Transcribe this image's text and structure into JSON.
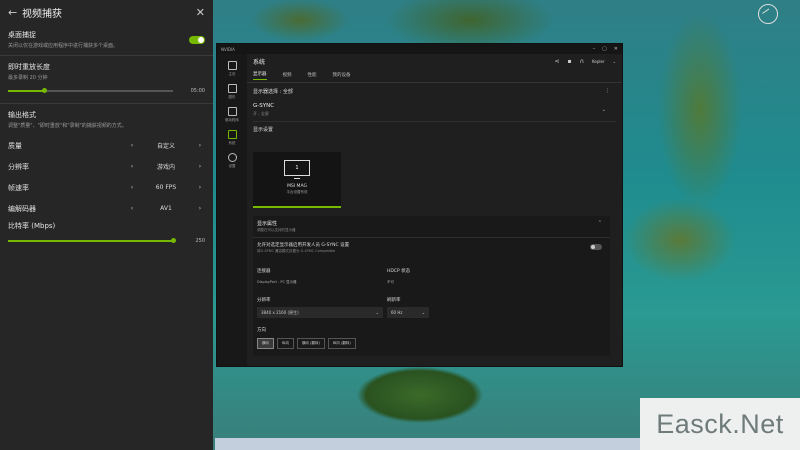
{
  "panel": {
    "title": "视频捕获",
    "desktop_capture": {
      "label": "桌面捕捉",
      "desc": "关闭以仅在游戏或应用程序中进行捕获多个桌面。",
      "enabled": true
    },
    "instant_replay": {
      "label": "即时重放长度",
      "desc": "最多录制 20 分钟",
      "value": "05:00",
      "fraction": 0.22
    },
    "output_format": {
      "label": "输出格式",
      "desc": "调整\"质量\"、\"即时重放\"和\"录制\"的捕获视频的方式。"
    },
    "options": [
      {
        "name": "质量",
        "value": "自定义"
      },
      {
        "name": "分辨率",
        "value": "游戏内"
      },
      {
        "name": "帧速率",
        "value": "60 FPS"
      },
      {
        "name": "编解码器",
        "value": "AV1"
      }
    ],
    "bitrate": {
      "label": "比特率 (Mbps)",
      "value": "250",
      "fraction": 1.0
    }
  },
  "window": {
    "app_name": "NVIDIA",
    "page_title": "系统",
    "account": "Kepler",
    "nav": [
      {
        "label": "主页"
      },
      {
        "label": "图形"
      },
      {
        "label": "驱动程序"
      },
      {
        "label": "系统"
      },
      {
        "label": "设置"
      }
    ],
    "tabs": [
      "显示器",
      "视频",
      "性能",
      "我的设备"
    ],
    "active_tab": 0,
    "select_display": "显示器选择 : 全部",
    "gsync": {
      "title": "G-SYNC",
      "sub": "开 , 全屏"
    },
    "display_settings": "显示设置",
    "monitor": {
      "number": "1",
      "name": "MSI MAG",
      "sub": "平台设置有效"
    },
    "props": {
      "title": "显示属性",
      "sub": "调整在可以支持的显示器",
      "gsync_toggle_label": "允许对选定显示器启用开发人员 G-SYNC 设置",
      "gsync_toggle_sub": "将G-SYNC 兼容模式设置为 G-SYNC Compatible",
      "connection_label": "连接器",
      "connection_value": "DisplayPort - PC 显示器",
      "hdcp_label": "HDCP 状态",
      "hdcp_value": "不可",
      "resolution_label": "分辨率",
      "resolution_value": "3840 x 2160 (原生)",
      "refresh_label": "刷新率",
      "refresh_value": "60 Hz",
      "orientation_label": "方向",
      "orientations": [
        "横向",
        "纵向",
        "横向 (翻转)",
        "纵向 (翻转)"
      ]
    }
  },
  "watermark": {
    "text": "Easck.Net"
  },
  "colors": {
    "accent": "#76b900"
  }
}
